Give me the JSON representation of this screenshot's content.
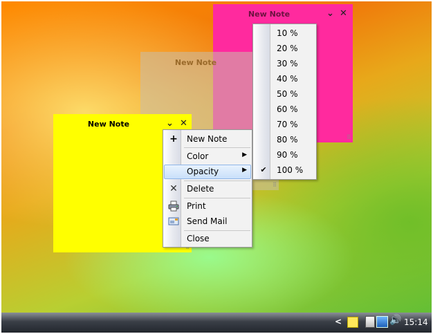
{
  "notes": [
    {
      "id": "pink",
      "title": "New Note",
      "color": "#ff2a9e"
    },
    {
      "id": "grey",
      "title": "New Note",
      "color": "#c9b79a"
    },
    {
      "id": "yellow",
      "title": "New Note",
      "color": "#ffff00"
    }
  ],
  "note_buttons": {
    "collapse": "⌄",
    "close": "✕"
  },
  "context_menu": {
    "items": [
      {
        "icon": "+",
        "label": "New Note"
      },
      {
        "label": "Color"
      },
      {
        "label": "Opacity"
      },
      {
        "icon": "✕",
        "label": "Delete"
      },
      {
        "icon": "printer",
        "label": "Print"
      },
      {
        "icon": "mail",
        "label": "Send Mail"
      },
      {
        "label": "Close"
      }
    ],
    "highlighted": "Opacity"
  },
  "opacity_menu": {
    "options": [
      "10 %",
      "20 %",
      "30 %",
      "40 %",
      "50 %",
      "60 %",
      "70 %",
      "80 %",
      "90 %",
      "100 %"
    ],
    "selected": "100 %",
    "check": "✔"
  },
  "taskbar": {
    "chevron": "<",
    "clock": "15:14"
  }
}
